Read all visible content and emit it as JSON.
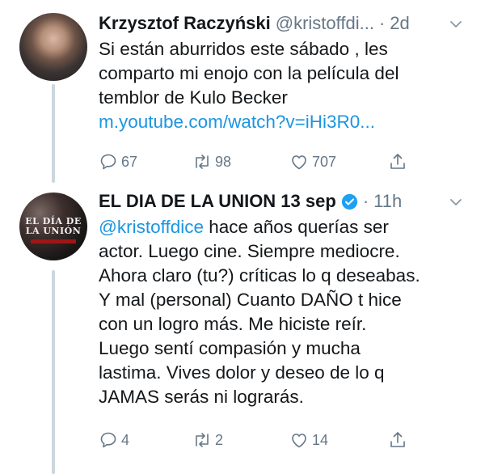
{
  "tweets": [
    {
      "author_name": "Krzysztof Raczyński",
      "handle": "@kristoffdi...",
      "dot": "·",
      "time": "2d",
      "verified": false,
      "avatar_icon": "person-photo",
      "body_lines": [
        "Si están aburridos este sábado , les",
        "comparto mi enojo con la película del",
        "temblor de Kulo Becker"
      ],
      "link": "m.youtube.com/watch?v=iHi3R0...",
      "actions": {
        "reply_count": "67",
        "retweet_count": "98",
        "like_count": "707"
      }
    },
    {
      "author_name": "EL DIA DE LA UNION 13 sep",
      "handle": "",
      "dot": "·",
      "time": "11h",
      "verified": true,
      "avatar_icon": "movie-poster",
      "avatar_poster_text": "EL DÍA DE LA UNIÓN",
      "mention": "@kristoffdice",
      "body_first_rest": " hace años querías ser",
      "body_lines": [
        "actor. Luego cine. Siempre mediocre.",
        "Ahora claro (tu?) críticas lo q deseabas.",
        "Y mal (personal) Cuanto DAÑO t hice",
        "con un logro más. Me hiciste reír.",
        "Luego sentí compasión y mucha",
        "lastima. Vives dolor y deseo de lo q",
        "JAMAS serás ni lograrás."
      ],
      "actions": {
        "reply_count": "4",
        "retweet_count": "2",
        "like_count": "14"
      }
    }
  ],
  "colors": {
    "text": "#14171a",
    "muted": "#657786",
    "link": "#1b95e0",
    "verified": "#1da1f2",
    "thread_line": "#ccd6dd"
  }
}
